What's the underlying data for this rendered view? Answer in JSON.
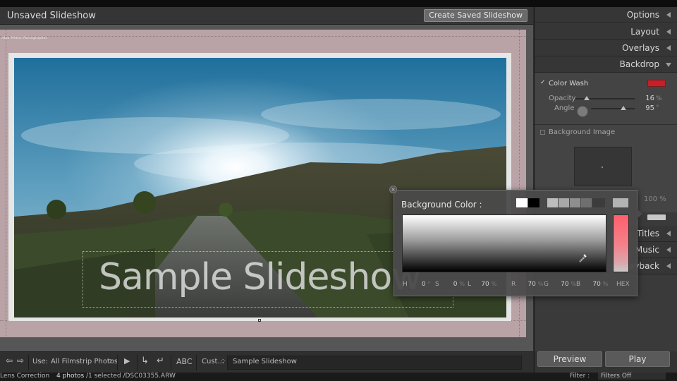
{
  "app": {
    "title": "Unsaved Slideshow",
    "create_button": "Create Saved Slideshow"
  },
  "slide": {
    "identity_plate": "Alan Welch Photographer",
    "overlay_text": "Sample Slideshow"
  },
  "toolbar": {
    "use_label": "Use:",
    "use_value": "All Filmstrip Photos",
    "abc": "ABC",
    "custom_label": "Cust...",
    "text_value": "Sample Slideshow"
  },
  "panel": {
    "sections": [
      "Options",
      "Layout",
      "Overlays",
      "Backdrop"
    ],
    "color_wash_label": "Color Wash",
    "color_wash_checked": true,
    "color_wash_color": "#c0212a",
    "opacity_label": "Opacity",
    "opacity_value": "16",
    "angle_label": "Angle",
    "angle_value": "95",
    "background_image_label": "Background Image",
    "background_image_opacity": "100 %",
    "lower_sections": [
      "Titles",
      "Music",
      "Playback"
    ],
    "preview_button": "Preview",
    "play_button": "Play"
  },
  "color_picker": {
    "title": "Background Color :",
    "swatches": [
      "#ffffff",
      "#000000",
      "#bdbdbd",
      "#a8a8a8",
      "#8e8e8e",
      "#6f6f6f",
      "#3c3c3c",
      "#b3b3b3"
    ],
    "H_label": "H",
    "H_value": "0",
    "S_label": "S",
    "S_value": "0",
    "L_label": "L",
    "L_value": "70",
    "R_label": "R",
    "R_value": "70",
    "G_label": "G",
    "G_value": "70",
    "B_label": "B",
    "B_value": "70",
    "hex_label": "HEX"
  },
  "status": {
    "left": "Lens Correction",
    "photos": "4 photos",
    "selection": "/1 selected /DSC03355.ARW",
    "filter_label": "Filter :",
    "filter_value": "Filters Off"
  },
  "colors": {
    "accent_wash": "#c0212a",
    "slide_background": "#b9a3a6"
  }
}
